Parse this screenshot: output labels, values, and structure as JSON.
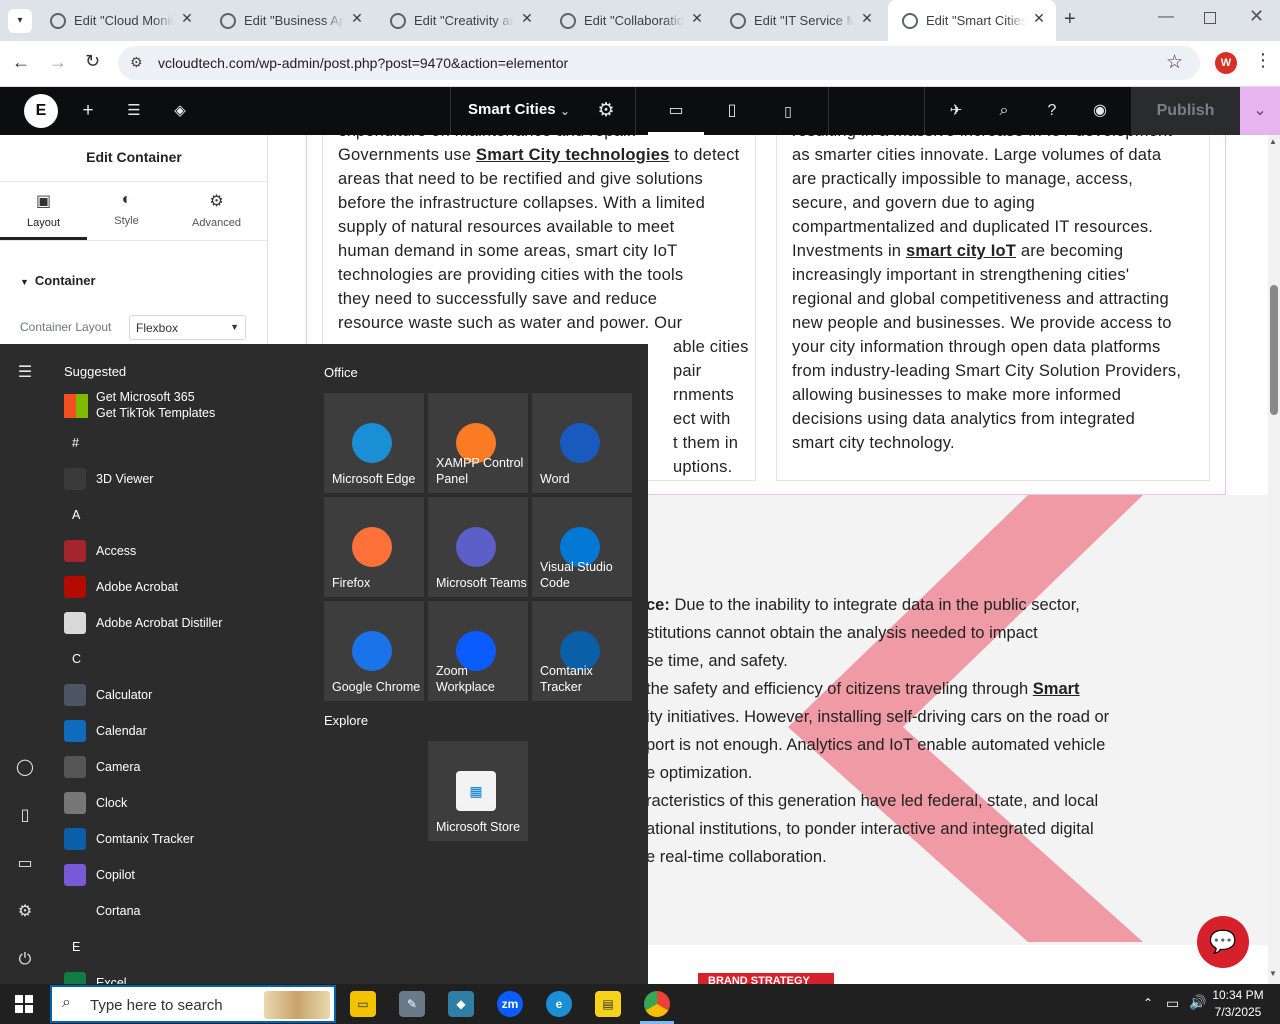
{
  "browser": {
    "tabs": [
      {
        "title": "Edit \"Cloud Monitoring\""
      },
      {
        "title": "Edit \"Business Apps\""
      },
      {
        "title": "Edit \"Creativity and\""
      },
      {
        "title": "Edit \"Collaboration\""
      },
      {
        "title": "Edit \"IT Service Ma\""
      },
      {
        "title": "Edit \"Smart Cities\""
      }
    ],
    "url": "vcloudtech.com/wp-admin/post.php?post=9470&action=elementor",
    "profile_initial": "W"
  },
  "elementor": {
    "page_name": "Smart Cities",
    "publish_label": "Publish",
    "panel": {
      "title": "Edit Container",
      "tabs": [
        {
          "label": "Layout"
        },
        {
          "label": "Style"
        },
        {
          "label": "Advanced"
        }
      ],
      "section_label": "Container",
      "container_layout_label": "Container Layout",
      "container_layout_value": "Flexbox"
    }
  },
  "content": {
    "col_left": {
      "line0": "expenditure on maintenance and repair.",
      "line1a": "Governments use ",
      "line1b": "Smart City technologies",
      "line1c": " to detect",
      "line2": "areas that need to be rectified and give solutions",
      "line3": "before the infrastructure collapses. With a limited",
      "line4": "supply of natural resources available to meet",
      "line5": "human demand in some areas, smart city IoT",
      "line6": "technologies are providing cities with the tools",
      "line7": "they need to successfully save and reduce",
      "line8": "resource waste such as water and power. Our",
      "line9": "able cities",
      "line10": "pair",
      "line11": "rnments",
      "line12": "ect with",
      "line13": "t them in",
      "line14": "uptions."
    },
    "col_right": {
      "line0": "resulting in a massive increase in IoT development",
      "line1": "as smarter cities innovate. Large volumes of data",
      "line2": "are practically impossible to manage, access,",
      "line3": "secure, and govern due to aging",
      "line4": "compartmentalized and duplicated IT resources.",
      "line5a": "Investments in ",
      "line5b": "smart city IoT",
      "line5c": " are becoming",
      "line6": "increasingly important in strengthening cities'",
      "line7": "regional and global competitiveness and attracting",
      "line8": "new people and businesses. We provide access to",
      "line9": "your city information through open data platforms",
      "line10": "from industry-leading Smart City Solution Providers,",
      "line11": "allowing businesses to make more informed",
      "line12": "decisions using data analytics from integrated",
      "line13": "smart city technology."
    },
    "lower": {
      "l1a": "ce:",
      "l1b": " Due to the inability to integrate data in the public sector,",
      "l2": "stitutions cannot obtain the analysis needed to impact",
      "l3": "se time, and safety.",
      "l4a": "the safety and efficiency of citizens traveling through ",
      "l4b": "Smart",
      "l5": "ity initiatives. However, installing self-driving cars on the road or",
      "l6": "port is not enough. Analytics and IoT enable automated vehicle",
      "l7": "e optimization.",
      "l8": "racteristics of this generation have led federal, state, and local",
      "l9": "ational institutions, to ponder interactive and integrated digital",
      "l10": "e real-time collaboration."
    },
    "badge": "BRAND STRATEGY"
  },
  "startmenu": {
    "suggested_label": "Suggested",
    "suggested_item": {
      "line1": "Get Microsoft 365",
      "line2": "Get TikTok Templates"
    },
    "apps": [
      {
        "type": "header",
        "label": "#"
      },
      {
        "type": "app",
        "label": "3D Viewer",
        "icon": "cube-icon",
        "color": "#3a3a3a"
      },
      {
        "type": "header",
        "label": "A"
      },
      {
        "type": "app",
        "label": "Access",
        "icon": "access-icon",
        "color": "#a4262c"
      },
      {
        "type": "app",
        "label": "Adobe Acrobat",
        "icon": "acrobat-icon",
        "color": "#b30b00"
      },
      {
        "type": "app",
        "label": "Adobe Acrobat Distiller",
        "icon": "distiller-icon",
        "color": "#d9d9d9"
      },
      {
        "type": "header",
        "label": "C"
      },
      {
        "type": "app",
        "label": "Calculator",
        "icon": "calculator-icon",
        "color": "#4b5563"
      },
      {
        "type": "app",
        "label": "Calendar",
        "icon": "calendar-icon",
        "color": "#0f6cbd"
      },
      {
        "type": "app",
        "label": "Camera",
        "icon": "camera-icon",
        "color": "#555"
      },
      {
        "type": "app",
        "label": "Clock",
        "icon": "clock-icon",
        "color": "#777"
      },
      {
        "type": "app",
        "label": "Comtanix Tracker",
        "icon": "tracker-icon",
        "color": "#0b5ea8"
      },
      {
        "type": "app",
        "label": "Copilot",
        "icon": "copilot-icon",
        "color": "#7a59d9"
      },
      {
        "type": "app",
        "label": "Cortana",
        "icon": "cortana-icon",
        "color": "#2c2c2c"
      },
      {
        "type": "header",
        "label": "E"
      },
      {
        "type": "app",
        "label": "Excel",
        "icon": "excel-icon",
        "color": "#107c41"
      }
    ],
    "office_label": "Office",
    "explore_label": "Explore",
    "tiles": [
      {
        "label": "Microsoft Edge",
        "icon": "edge-icon",
        "color": "#1b8fd6"
      },
      {
        "label": "XAMPP Control Panel",
        "icon": "xampp-icon",
        "color": "#fb7a24"
      },
      {
        "label": "Word",
        "icon": "word-icon",
        "color": "#185abd"
      },
      {
        "label": "Firefox",
        "icon": "firefox-icon",
        "color": "#ff7139"
      },
      {
        "label": "Microsoft Teams",
        "icon": "teams-icon",
        "color": "#5b5fc7"
      },
      {
        "label": "Visual Studio Code",
        "icon": "vscode-icon",
        "color": "#0078d4"
      },
      {
        "label": "Google Chrome",
        "icon": "chrome-icon",
        "color": "#1a73e8"
      },
      {
        "label": "Zoom Workplace",
        "icon": "zoom-icon",
        "color": "#0b5cff"
      },
      {
        "label": "Comtanix Tracker",
        "icon": "tracker-icon",
        "color": "#0b5ea8"
      }
    ],
    "store_tile": {
      "label": "Microsoft Store",
      "icon": "store-icon"
    }
  },
  "taskbar": {
    "search_placeholder": "Type here to search",
    "time": "10:34 PM",
    "date": "7/3/2025"
  }
}
